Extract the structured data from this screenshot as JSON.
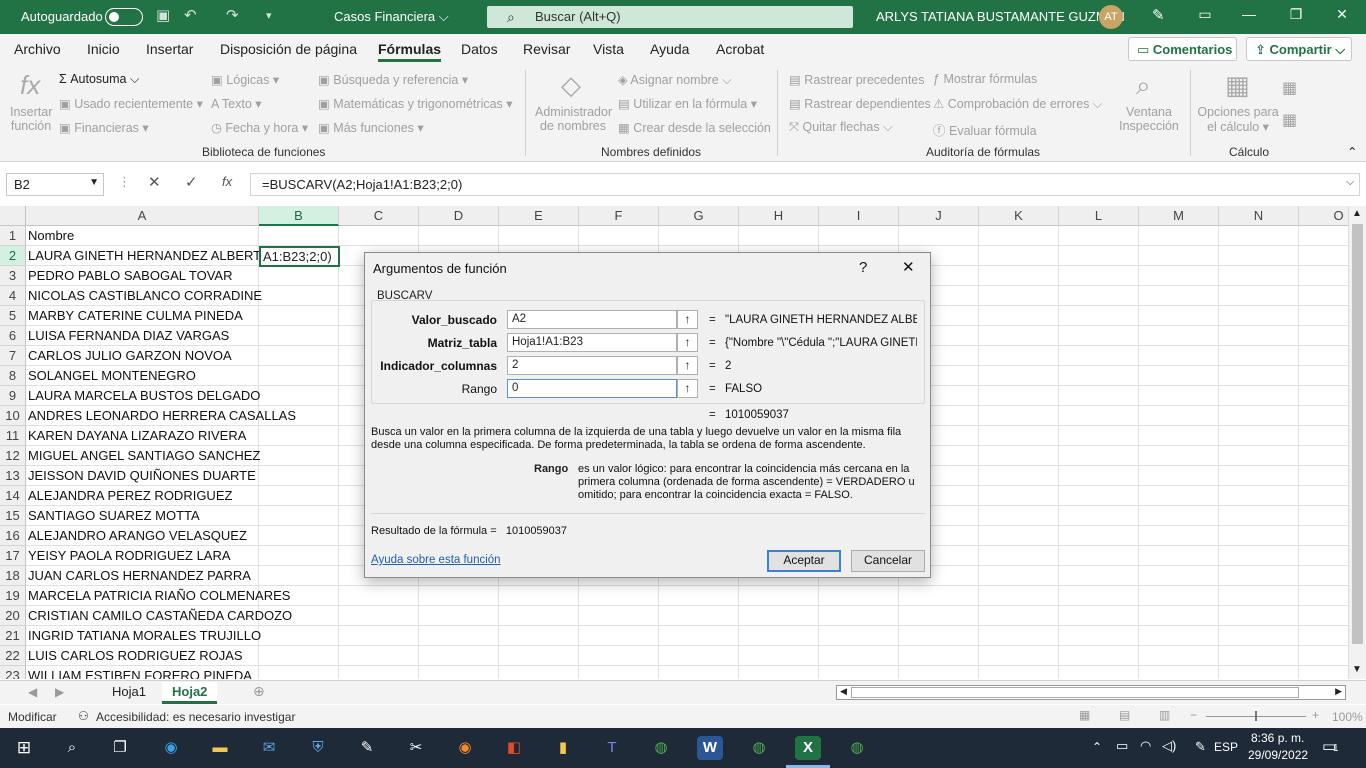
{
  "titlebar": {
    "autosave_label": "Autoguardado",
    "doc_title": "Casos Financiera",
    "search_placeholder": "Buscar (Alt+Q)",
    "user_name": "ARLYS TATIANA BUSTAMANTE GUZMAN",
    "user_initials": "AT"
  },
  "menu": {
    "items": [
      "Archivo",
      "Inicio",
      "Insertar",
      "Disposición de página",
      "Fórmulas",
      "Datos",
      "Revisar",
      "Vista",
      "Ayuda",
      "Acrobat"
    ],
    "active": "Fórmulas",
    "comments_label": "Comentarios",
    "share_label": "Compartir"
  },
  "ribbon": {
    "insert_function": [
      "Insertar",
      "función"
    ],
    "autosum": "Autosuma",
    "recent": "Usado recientemente",
    "financial": "Financieras",
    "logical": "Lógicas",
    "text": "Texto",
    "datetime": "Fecha y hora",
    "lookup": "Búsqueda y referencia",
    "math": "Matemáticas y trigonométricas",
    "more": "Más funciones",
    "group_library": "Biblioteca de funciones",
    "name_manager": [
      "Administrador",
      "de nombres"
    ],
    "define_name": "Asignar nombre",
    "use_in_formula": "Utilizar en la fórmula",
    "create_from_selection": "Crear desde la selección",
    "group_names": "Nombres definidos",
    "trace_precedents": "Rastrear precedentes",
    "trace_dependents": "Rastrear dependientes",
    "remove_arrows": "Quitar flechas",
    "show_formulas": "Mostrar fórmulas",
    "error_checking": "Comprobación de errores",
    "evaluate_formula": "Evaluar fórmula",
    "watch_window": [
      "Ventana",
      "Inspección"
    ],
    "group_audit": "Auditoría de fórmulas",
    "calc_options": [
      "Opciones para",
      "el cálculo"
    ],
    "group_calc": "Cálculo"
  },
  "formula_bar": {
    "name_box": "B2",
    "fx": "fx",
    "formula": "=BUSCARV(A2;Hoja1!A1:B23;2;0)"
  },
  "sheet": {
    "columns": [
      "A",
      "B",
      "C",
      "D",
      "E",
      "F",
      "G",
      "H",
      "I",
      "J",
      "K",
      "L",
      "M",
      "N",
      "O"
    ],
    "rows": [
      "Nombre",
      "LAURA GINETH HERNANDEZ ALBERTO",
      "PEDRO PABLO SABOGAL TOVAR",
      "NICOLAS CASTIBLANCO CORRADINE",
      "MARBY CATERINE  CULMA PINEDA",
      "LUISA FERNANDA DIAZ VARGAS",
      "CARLOS JULIO GARZON NOVOA",
      "SOLANGEL MONTENEGRO",
      "LAURA MARCELA BUSTOS DELGADO",
      "ANDRES LEONARDO HERRERA CASALLAS",
      "KAREN DAYANA LIZARAZO RIVERA",
      "MIGUEL ANGEL SANTIAGO SANCHEZ",
      "JEISSON DAVID QUIÑONES DUARTE",
      "ALEJANDRA PEREZ RODRIGUEZ",
      "SANTIAGO SUAREZ MOTTA",
      "ALEJANDRO ARANGO VELASQUEZ",
      "YEISY PAOLA RODRIGUEZ LARA",
      "JUAN CARLOS HERNANDEZ PARRA",
      "MARCELA PATRICIA RIAÑO COLMENARES",
      "CRISTIAN CAMILO  CASTAÑEDA CARDOZO",
      "INGRID TATIANA MORALES TRUJILLO",
      "LUIS CARLOS RODRIGUEZ ROJAS",
      "WILLIAM ESTIBEN FORERO PINEDA"
    ],
    "b2_value": "A1:B23;2;0)"
  },
  "tabs": {
    "sheets": [
      "Hoja1",
      "Hoja2"
    ],
    "active": "Hoja2"
  },
  "status": {
    "mode": "Modificar",
    "accessibility": "Accesibilidad: es necesario investigar",
    "zoom": "100%"
  },
  "taskbar": {
    "time": "8:36 p. m.",
    "date": "29/09/2022",
    "lang": "ESP",
    "notifications": "1"
  },
  "dialog": {
    "title": "Argumentos de función",
    "help_glyph": "?",
    "close_glyph": "✕",
    "function_name": "BUSCARV",
    "args": [
      {
        "label": "Valor_buscado",
        "value": "A2",
        "result": "\"LAURA GINETH HERNANDEZ ALBE...",
        "bold": true
      },
      {
        "label": "Matriz_tabla",
        "value": "Hoja1!A1:B23",
        "result": "{\"Nombre \"\\\"Cédula \";\"LAURA GINETH",
        "bold": true
      },
      {
        "label": "Indicador_columnas",
        "value": "2",
        "result": "2",
        "bold": true
      },
      {
        "label": "Rango",
        "value": "0",
        "result": "FALSO",
        "bold": false
      }
    ],
    "equals": "=",
    "overall_result": "1010059037",
    "description": "Busca un valor en la primera columna de la izquierda de una tabla y luego devuelve un valor en la misma fila desde una columna especificada. De forma predeterminada, la tabla se ordena de forma ascendente.",
    "param_name": "Rango",
    "param_desc": "es un valor lógico: para encontrar la coincidencia más cercana en la primera columna (ordenada de forma ascendente) = VERDADERO u omitido; para encontrar la coincidencia exacta = FALSO.",
    "result_label": "Resultado de la fórmula =",
    "result_value": "1010059037",
    "help_link": "Ayuda sobre esta función",
    "ok": "Aceptar",
    "cancel": "Cancelar"
  }
}
